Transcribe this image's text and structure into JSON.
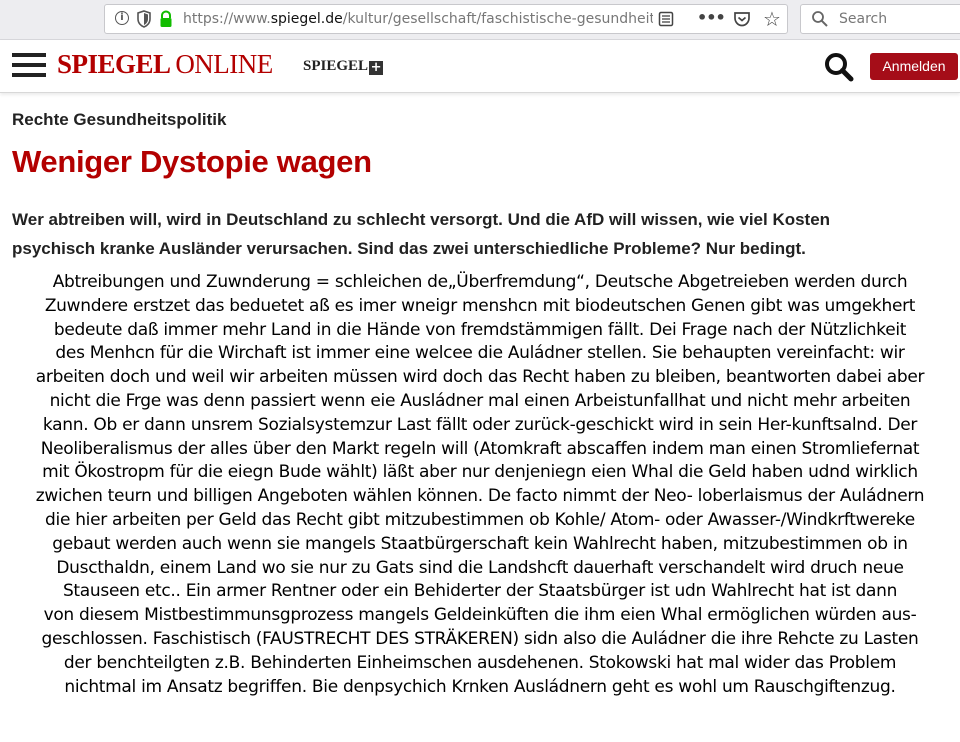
{
  "browser": {
    "url_prefix": "https://www.",
    "url_domain": "spiegel.de",
    "url_path": "/kultur/gesellschaft/faschistische-gesundheits",
    "search_placeholder": "Search",
    "more_label": "•••",
    "star_label": "☆"
  },
  "header": {
    "logo_spiegel": "SPIEGEL",
    "logo_online": "ONLINE",
    "plus_label": "SPIEGEL",
    "plus_symbol": "+",
    "login_label": "Anmelden"
  },
  "article": {
    "kicker": "Rechte Gesundheitspolitik",
    "headline": "Weniger Dystopie wagen",
    "teaser_lines": [
      "Wer abtreiben will, wird in Deutschland zu schlecht versorgt. Und die AfD will wissen, wie viel Kosten",
      "psychisch kranke Ausländer verursachen. Sind das zwei unterschiedliche Probleme? Nur bedingt."
    ]
  },
  "body_lines": [
    "Abtreibungen und Zuwnderung = schleichen de„Überfremdung“, Deutsche Abgetreieben werden durch",
    "Zuwndere erstzet das beduetet aß es imer wneigr menshcn mit biodeutschen Genen gibt was umgekhert",
    "bedeute daß immer mehr Land in die Hände von fremdstämmigen fällt.  Dei Frage nach der Nützlichkeit",
    "des Menhcn für die Wirchaft ist immer eine welcee die Auládner stellen. Sie behaupten vereinfacht: wir",
    "arbeiten doch und weil wir arbeiten müssen wird doch das Recht haben zu bleiben, beantworten dabei aber",
    "nicht die Frge was denn passiert wenn eie Ausládner mal einen Arbeistunfallhat und nicht mehr arbeiten",
    "kann. Ob er dann unsrem Sozialsystemzur Last fällt oder zurück-geschickt wird in sein Her-kunftsalnd. Der",
    "Neoliberalismus der alles über den Markt regeln will (Atomkraft abscaffen indem man einen Stromliefernat",
    "mit Ökostropm für die eiegn Bude wählt) läßt aber nur denjeniegn eien Whal die Geld haben udnd wirklich",
    "zwichen teurn und billigen Angeboten wählen können. De facto nimmt der Neo- loberlaismus der Auládnern",
    "die hier arbeiten per Geld das Recht gibt mitzubestimmen ob Kohle/ Atom- oder Awasser-/Windkrftwereke",
    "gebaut werden auch wenn sie mangels Staatbürgerschaft kein Wahlrecht haben, mitzubestimmen ob in",
    "Duscthaldn, einem Land wo sie nur zu Gats sind die Landshcft dauerhaft verschandelt wird druch neue",
    "Stauseen etc.. Ein armer Rentner oder ein Behiderter der Staatsbürger ist udn Wahlrecht hat ist dann",
    "von diesem Mistbestimmunsgprozess mangels Geldeinküften die ihm eien Whal ermöglichen würden aus-",
    "geschlossen. Faschistisch (FAUSTRECHT DES STRÄKEREN)  sidn also die Auládner die ihre Rehcte zu Lasten",
    "der benchteilgten z.B. Behinderten Einheimschen ausdehenen. Stokowski hat mal wider das Problem",
    "nichtmal im Ansatz begriffen. Bie denpsychich Krnken Ausládnern geht es wohl um Rauschgiftenzug."
  ]
}
